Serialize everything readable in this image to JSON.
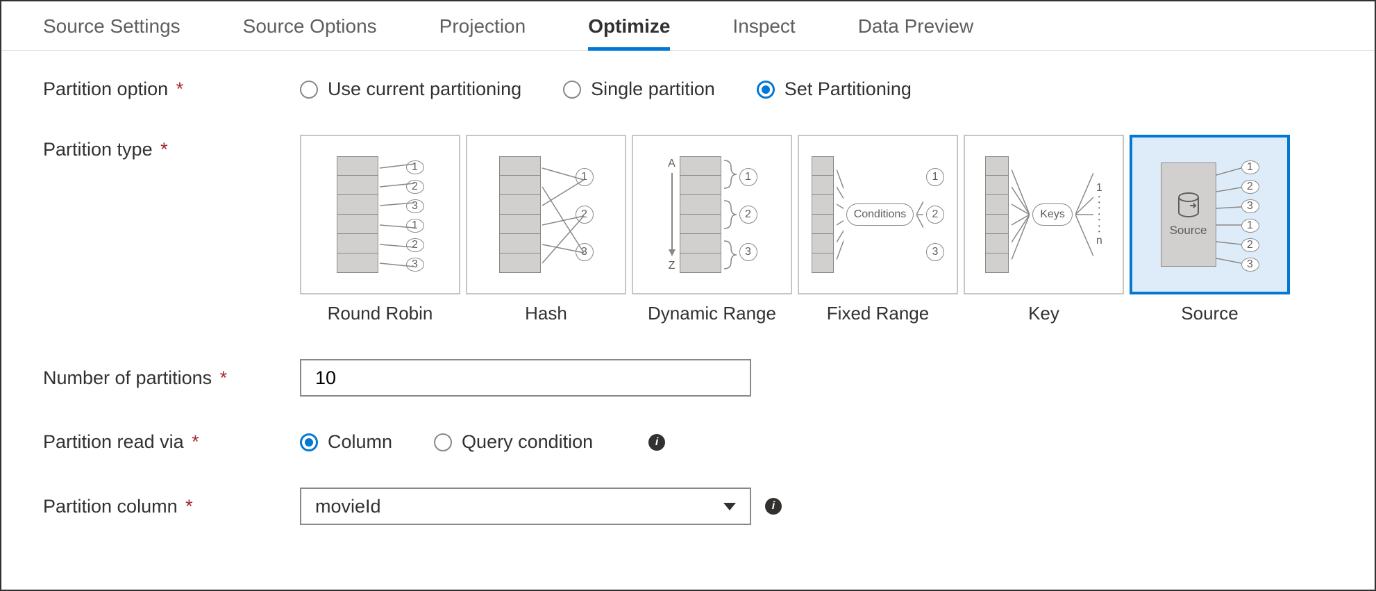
{
  "tabs": [
    {
      "label": "Source Settings",
      "active": false
    },
    {
      "label": "Source Options",
      "active": false
    },
    {
      "label": "Projection",
      "active": false
    },
    {
      "label": "Optimize",
      "active": true
    },
    {
      "label": "Inspect",
      "active": false
    },
    {
      "label": "Data Preview",
      "active": false
    }
  ],
  "labels": {
    "partition_option": "Partition option",
    "partition_type": "Partition type",
    "num_partitions": "Number of partitions",
    "partition_read_via": "Partition read via",
    "partition_column": "Partition column"
  },
  "partition_option": {
    "options": [
      {
        "label": "Use current partitioning",
        "selected": false
      },
      {
        "label": "Single partition",
        "selected": false
      },
      {
        "label": "Set Partitioning",
        "selected": true
      }
    ]
  },
  "partition_type": {
    "types": [
      {
        "label": "Round Robin",
        "selected": false
      },
      {
        "label": "Hash",
        "selected": false
      },
      {
        "label": "Dynamic Range",
        "selected": false
      },
      {
        "label": "Fixed Range",
        "selected": false
      },
      {
        "label": "Key",
        "selected": false
      },
      {
        "label": "Source",
        "selected": true
      }
    ],
    "conditions_label": "Conditions",
    "keys_label": "Keys",
    "source_inner_label": "Source",
    "range_letters": {
      "top": "A",
      "bottom": "Z"
    }
  },
  "num_partitions_value": "10",
  "partition_read_via": {
    "options": [
      {
        "label": "Column",
        "selected": true
      },
      {
        "label": "Query condition",
        "selected": false
      }
    ]
  },
  "partition_column_value": "movieId"
}
